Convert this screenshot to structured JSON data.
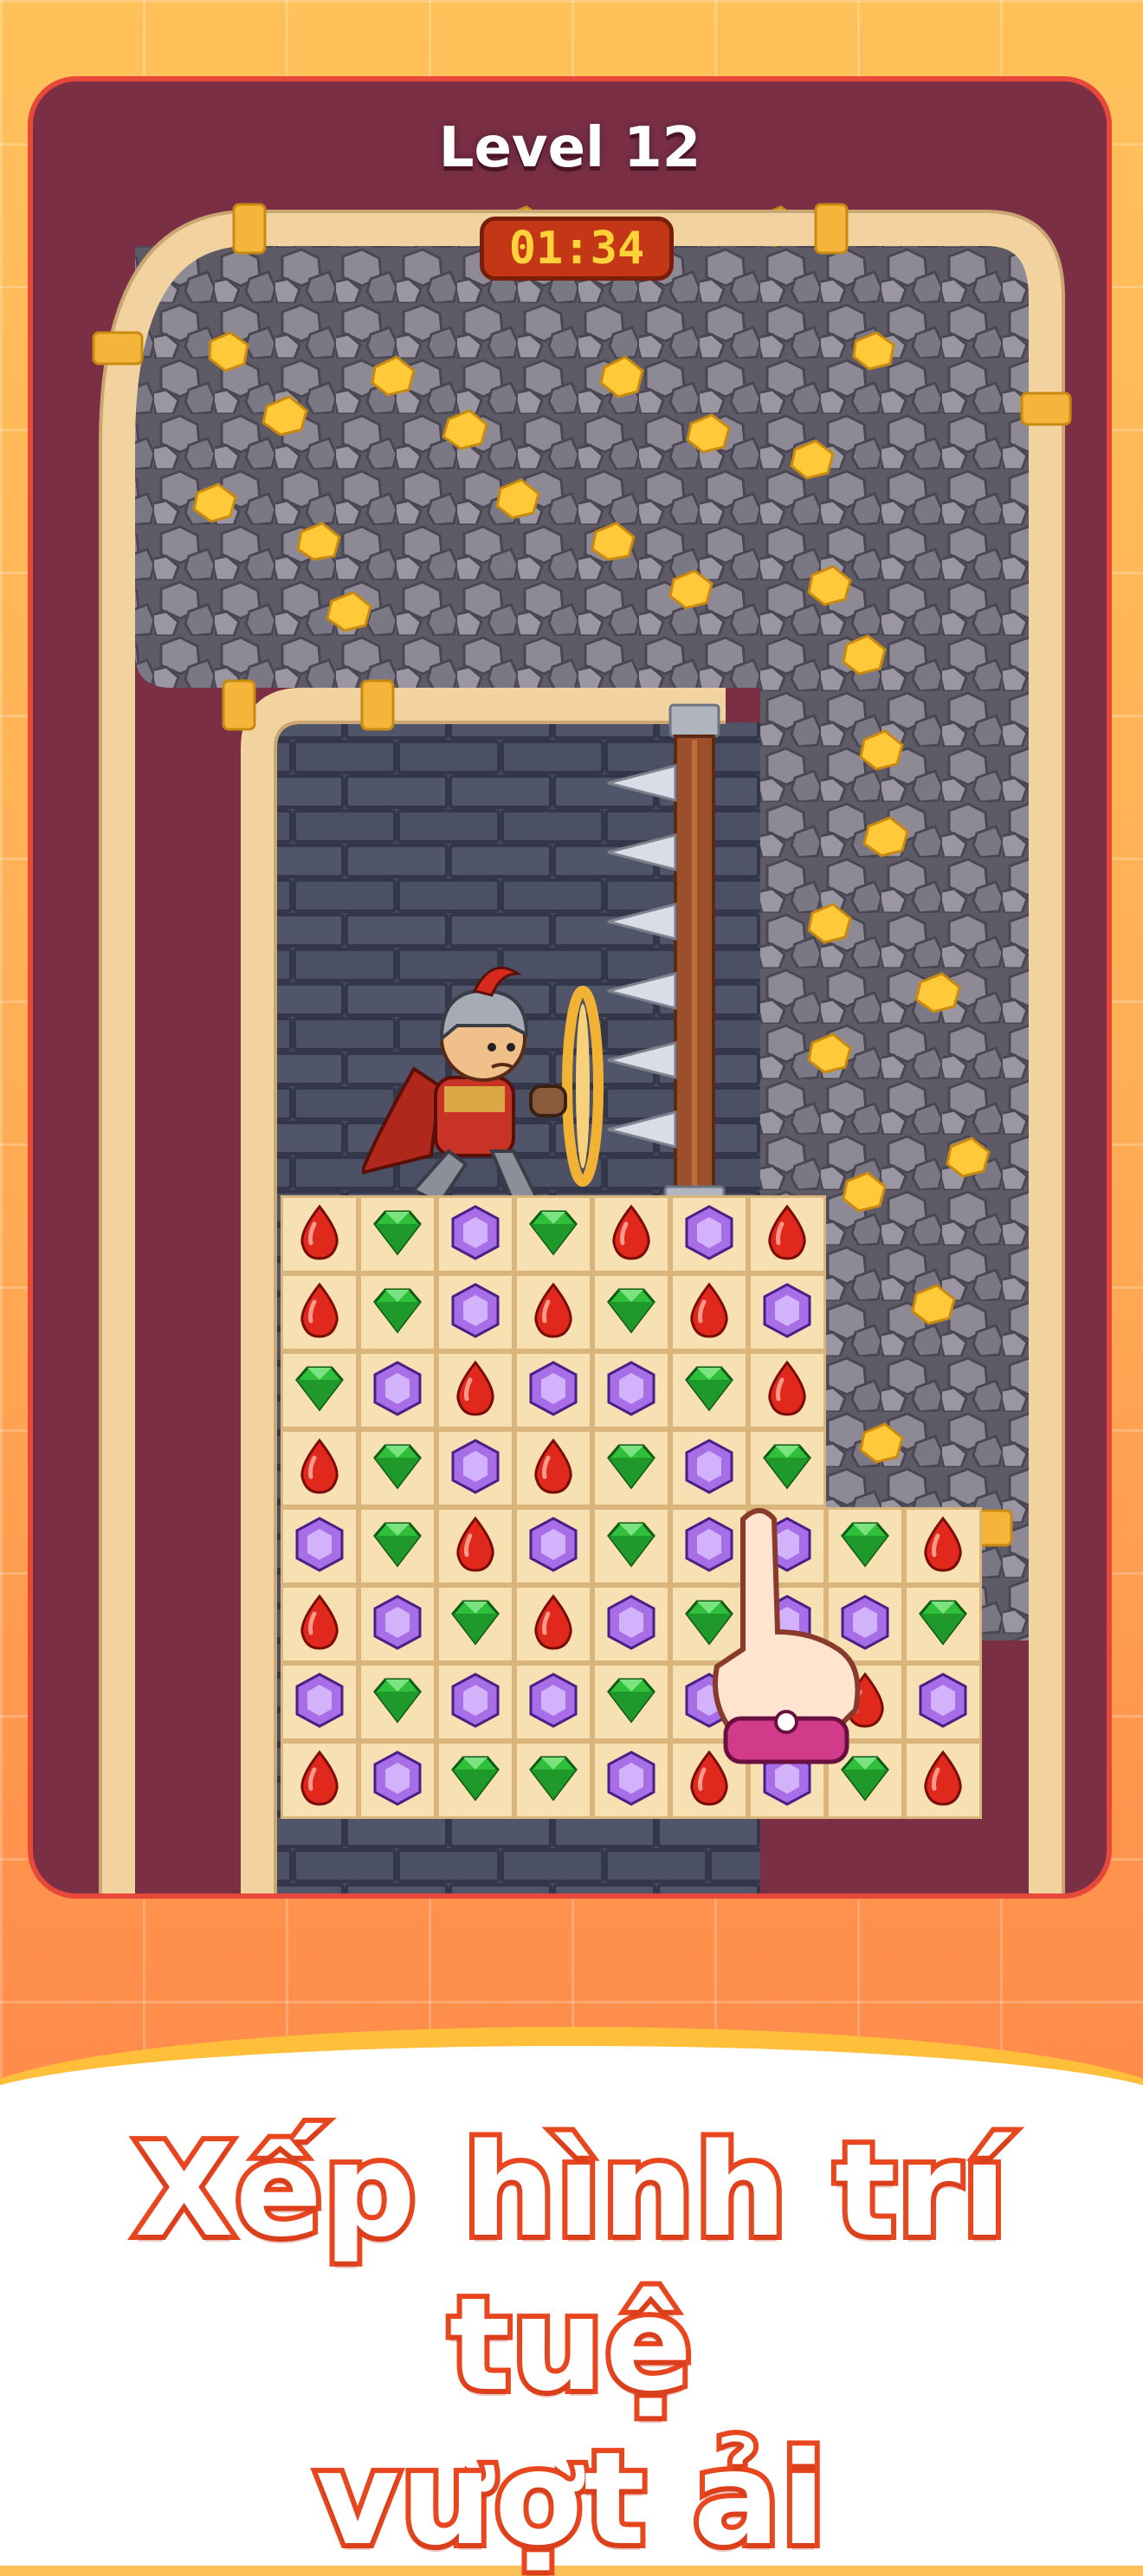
{
  "game": {
    "level_label": "Level 12",
    "timer": "01:34"
  },
  "board": {
    "main_rows": [
      [
        "red",
        "green",
        "purple",
        "green",
        "red",
        "purple",
        "red"
      ],
      [
        "red",
        "green",
        "purple",
        "red",
        "green",
        "red",
        "purple"
      ],
      [
        "green",
        "purple",
        "red",
        "purple",
        "purple",
        "green",
        "red"
      ],
      [
        "red",
        "green",
        "purple",
        "red",
        "green",
        "purple",
        "green"
      ],
      [
        "purple",
        "green",
        "red",
        "purple",
        "green",
        "purple",
        "purple"
      ],
      [
        "red",
        "purple",
        "green",
        "red",
        "purple",
        "green",
        "purple"
      ],
      [
        "purple",
        "green",
        "purple",
        "purple",
        "green",
        "purple",
        "green"
      ],
      [
        "red",
        "purple",
        "green",
        "green",
        "purple",
        "red",
        "purple"
      ]
    ],
    "extension_rows": [
      [
        "green",
        "red"
      ],
      [
        "purple",
        "green"
      ],
      [
        "red",
        "purple"
      ],
      [
        "green",
        "red"
      ]
    ]
  },
  "icons": {
    "red": "red-gem-icon",
    "green": "green-gem-icon",
    "purple": "purple-gem-icon",
    "hand": "tap-hand-icon",
    "knight": "knight-hero"
  },
  "colors": {
    "card": "#7a2f45",
    "accent": "#e8461f",
    "wall": "#f2d3a0",
    "gold": "#ffc93a"
  },
  "promo": {
    "line1": "Xếp hình trí tuệ",
    "line2": "vượt ải"
  }
}
